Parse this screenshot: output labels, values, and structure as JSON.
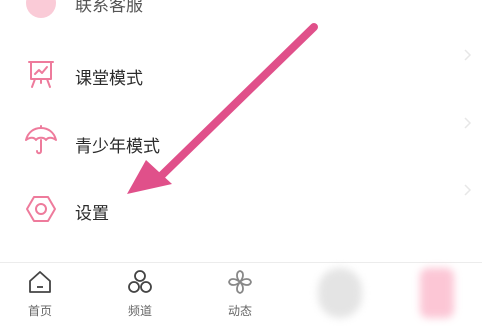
{
  "menu": {
    "items": [
      {
        "label": "联系客服",
        "icon": "headset-icon"
      },
      {
        "label": "课堂模式",
        "icon": "classroom-board-icon"
      },
      {
        "label": "青少年模式",
        "icon": "umbrella-icon"
      },
      {
        "label": "设置",
        "icon": "hexagon-gear-icon"
      }
    ]
  },
  "tabbar": {
    "tabs": [
      {
        "label": "首页",
        "icon": "home-icon"
      },
      {
        "label": "频道",
        "icon": "channel-circles-icon"
      },
      {
        "label": "动态",
        "icon": "pinwheel-icon"
      }
    ]
  },
  "colors": {
    "accent_pink": "#e8578a",
    "icon_pink": "#f07fa0",
    "text": "#2b2b2b"
  }
}
